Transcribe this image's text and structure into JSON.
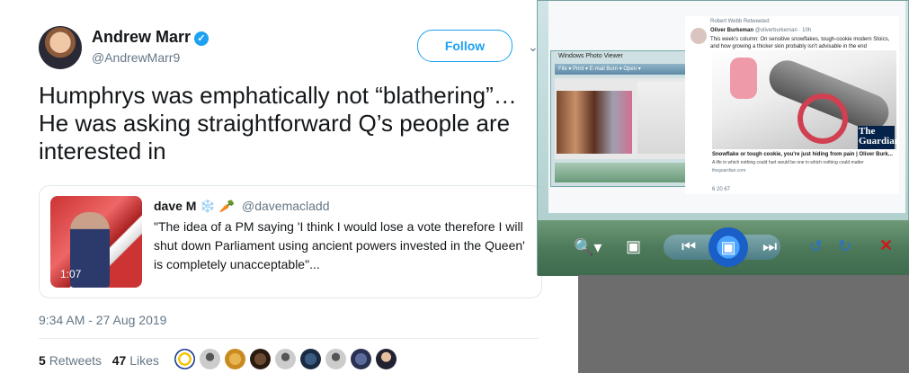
{
  "tweet": {
    "name": "Andrew Marr",
    "verified": "✓",
    "handle": "@AndrewMarr9",
    "follow_label": "Follow",
    "text": "Humphrys was emphatically not “blathering”…He was asking straightforward Q’s people are interested in",
    "time": "9:34 AM - 27 Aug 2019",
    "retweets_count": "5",
    "retweets_label": "Retweets",
    "likes_count": "47",
    "likes_label": "Likes"
  },
  "quote": {
    "name": "dave M",
    "emoji": "❄️ 🥕",
    "handle": "@davemacladd",
    "text": "\"The idea of a PM saying 'I think I would lose a vote therefore I will shut down Parliament using ancient powers invested in the Queen' is completely unacceptable\"...",
    "video_duration": "1:07"
  },
  "viewer": {
    "inner_title": "Windows Photo Viewer",
    "inner_menu": "File ▾   Print ▾   E-mail   Burn ▾   Open ▾",
    "embed": {
      "retweet_line": "Robert Webb Retweeted",
      "author": "Oliver Burkeman",
      "author_meta": "@oliverburkeman · 10h",
      "text": "This week's column: On sensitive snowflakes, tough-cookie modern Stoics, and how growing a thicker skin probably isn't advisable in the end",
      "logo": "The Guardian",
      "card_title": "Snowflake or tough cookie, you're just hiding from pain | Oliver Burk...",
      "card_desc": "A life in which nothing could hurt would be one in which nothing could matter",
      "card_source": "theguardian.com",
      "actions": "6      20      67"
    }
  },
  "colors": {
    "accent": "#1da1f2",
    "text": "#14171a",
    "muted": "#657786",
    "guardian": "#05224a"
  }
}
